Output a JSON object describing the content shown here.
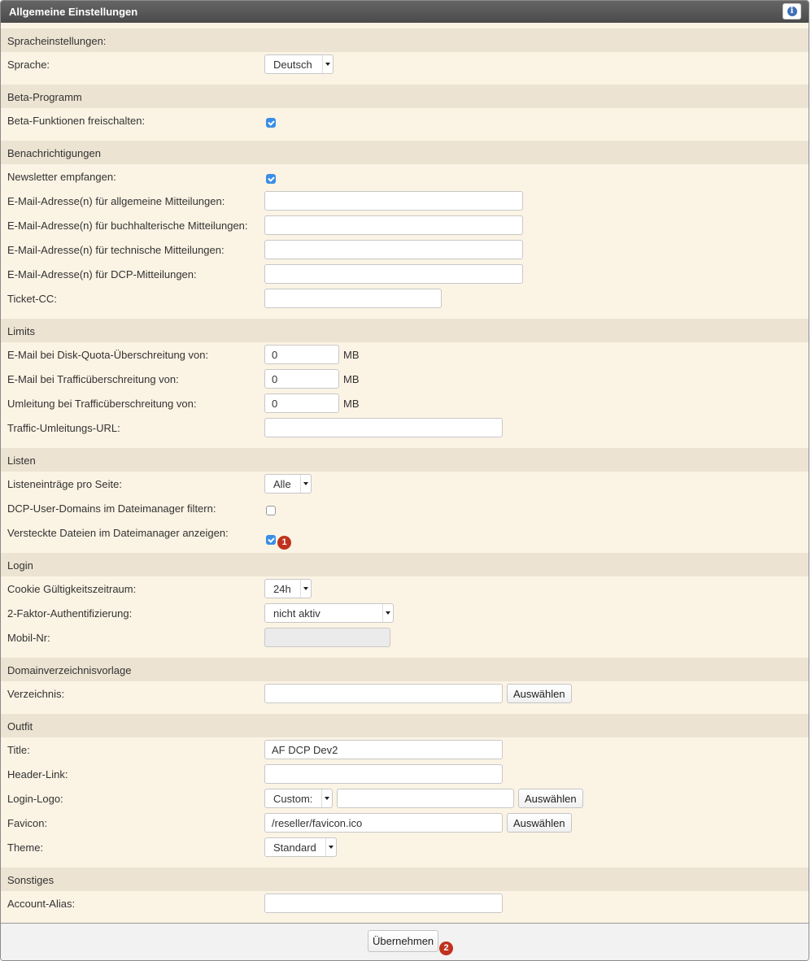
{
  "title": "Allgemeine Einstellungen",
  "info_icon": "i",
  "sections": {
    "sprache": {
      "head": "Spracheinstellungen:",
      "label": "Sprache:",
      "value": "Deutsch"
    },
    "beta": {
      "head": "Beta-Programm",
      "label": "Beta-Funktionen freischalten:",
      "checked": true
    },
    "notify": {
      "head": "Benachrichtigungen",
      "newsletter_label": "Newsletter empfangen:",
      "newsletter_checked": true,
      "email_general_label": "E-Mail-Adresse(n) für allgemeine Mitteilungen:",
      "email_general_value": "",
      "email_accounting_label": "E-Mail-Adresse(n) für buchhalterische Mitteilungen:",
      "email_accounting_value": "",
      "email_tech_label": "E-Mail-Adresse(n) für technische Mitteilungen:",
      "email_tech_value": "",
      "email_dcp_label": "E-Mail-Adresse(n) für DCP-Mitteilungen:",
      "email_dcp_value": "",
      "ticket_cc_label": "Ticket-CC:",
      "ticket_cc_value": ""
    },
    "limits": {
      "head": "Limits",
      "disk_label": "E-Mail bei Disk-Quota-Überschreitung von:",
      "disk_value": "0",
      "traffic_label": "E-Mail bei Trafficüberschreitung von:",
      "traffic_value": "0",
      "redirect_label": "Umleitung bei Trafficüberschreitung von:",
      "redirect_value": "0",
      "unit": "MB",
      "url_label": "Traffic-Umleitungs-URL:",
      "url_value": ""
    },
    "listen": {
      "head": "Listen",
      "per_page_label": "Listeneinträge pro Seite:",
      "per_page_value": "Alle",
      "filter_label": "DCP-User-Domains im Dateimanager filtern:",
      "filter_checked": false,
      "hidden_label": "Versteckte Dateien im Dateimanager anzeigen:",
      "hidden_checked": true,
      "badge": "1"
    },
    "login": {
      "head": "Login",
      "cookie_label": "Cookie Gültigkeitszeitraum:",
      "cookie_value": "24h",
      "twofa_label": "2-Faktor-Authentifizierung:",
      "twofa_value": "nicht aktiv",
      "mobile_label": "Mobil-Nr:",
      "mobile_value": ""
    },
    "domain": {
      "head": "Domainverzeichnisvorlage",
      "dir_label": "Verzeichnis:",
      "dir_value": "",
      "choose": "Auswählen"
    },
    "outfit": {
      "head": "Outfit",
      "title_label": "Title:",
      "title_value": "AF DCP Dev2",
      "header_link_label": "Header-Link:",
      "header_link_value": "",
      "logo_label": "Login-Logo:",
      "logo_select": "Custom:",
      "logo_value": "",
      "favicon_label": "Favicon:",
      "favicon_value": "/reseller/favicon.ico",
      "theme_label": "Theme:",
      "theme_value": "Standard",
      "choose": "Auswählen"
    },
    "misc": {
      "head": "Sonstiges",
      "alias_label": "Account-Alias:",
      "alias_value": ""
    }
  },
  "footer": {
    "apply": "Übernehmen",
    "badge": "2"
  }
}
